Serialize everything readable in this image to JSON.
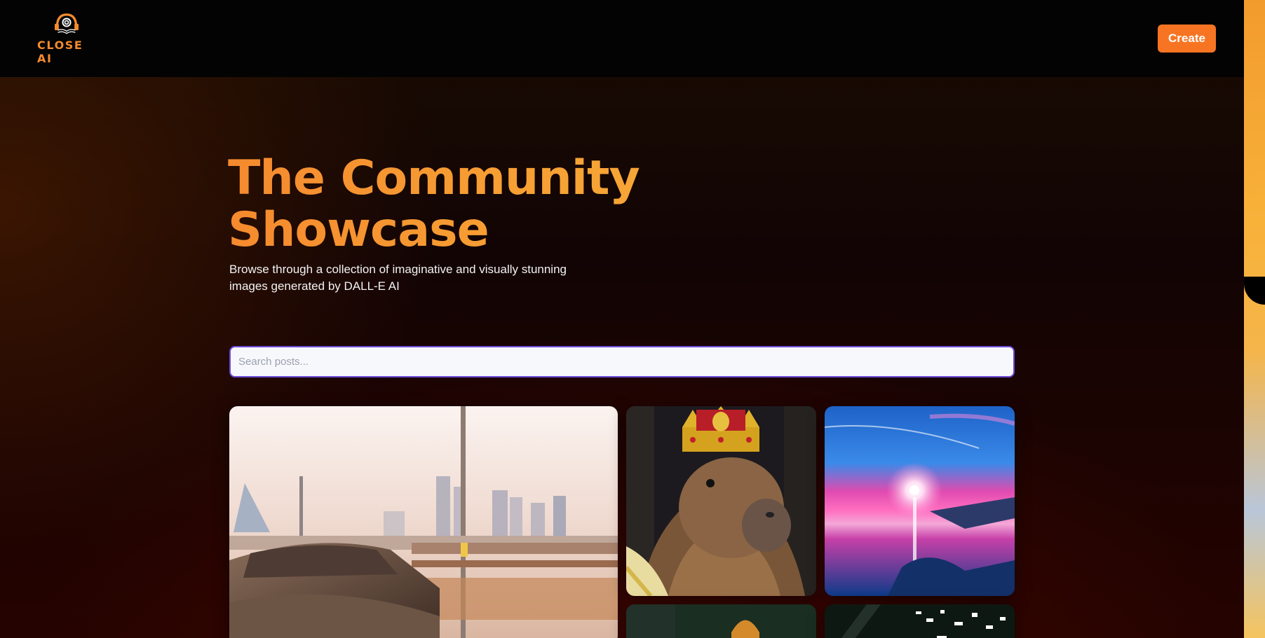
{
  "header": {
    "logo_text": "CLOSE AI",
    "logo_icon": "headphone-book-logo",
    "create_label": "Create"
  },
  "hero": {
    "title_line1": "The Community",
    "title_line2": "Showcase",
    "subtitle": "Browse through a collection of imaginative and visually stunning images generated by DALL-E AI"
  },
  "search": {
    "value": "",
    "placeholder": "Search posts..."
  },
  "gallery": {
    "images": [
      "car-on-highway-city-skyline",
      "capybara-king-with-crown",
      "pink-ocean-sunset",
      "crowned-animal-partial",
      "night-city-lights-partial"
    ]
  },
  "colors": {
    "accent": "#f77522",
    "title_gradient_start": "#f58a2e",
    "title_gradient_end": "#f5a938",
    "search_border": "#6c4ad8",
    "header_bg": "#030303"
  }
}
